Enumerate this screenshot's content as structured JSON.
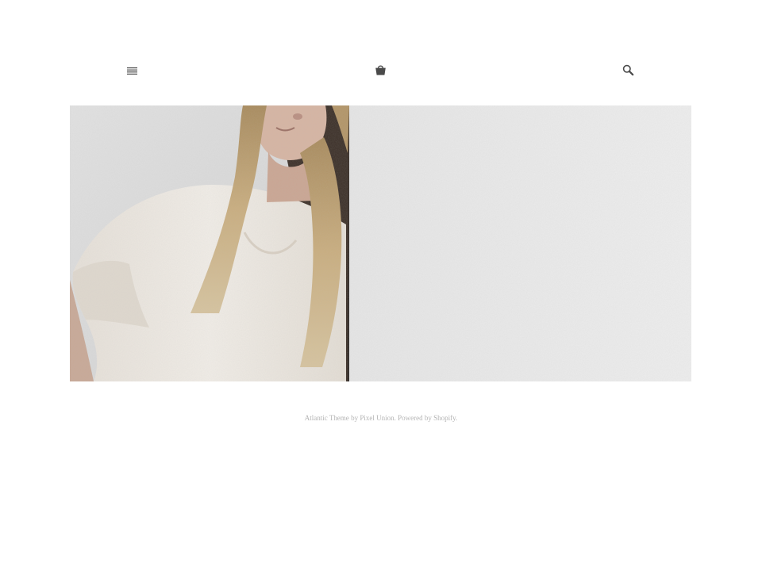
{
  "header": {
    "menu_icon": "hamburger-menu-icon",
    "cart_icon": "shopping-bag-icon",
    "search_icon": "search-icon",
    "icon_color": "#4a4a4a"
  },
  "hero": {
    "image": "woman-in-white-tshirt-photo",
    "background_color": "#ebebeb"
  },
  "footer": {
    "theme_link": "Atlantic Theme",
    "by_text": "by",
    "author_link": "Pixel Union",
    "powered_text": "Powered by",
    "platform_link": "Shopify",
    "text_color": "#b4b4b4"
  }
}
